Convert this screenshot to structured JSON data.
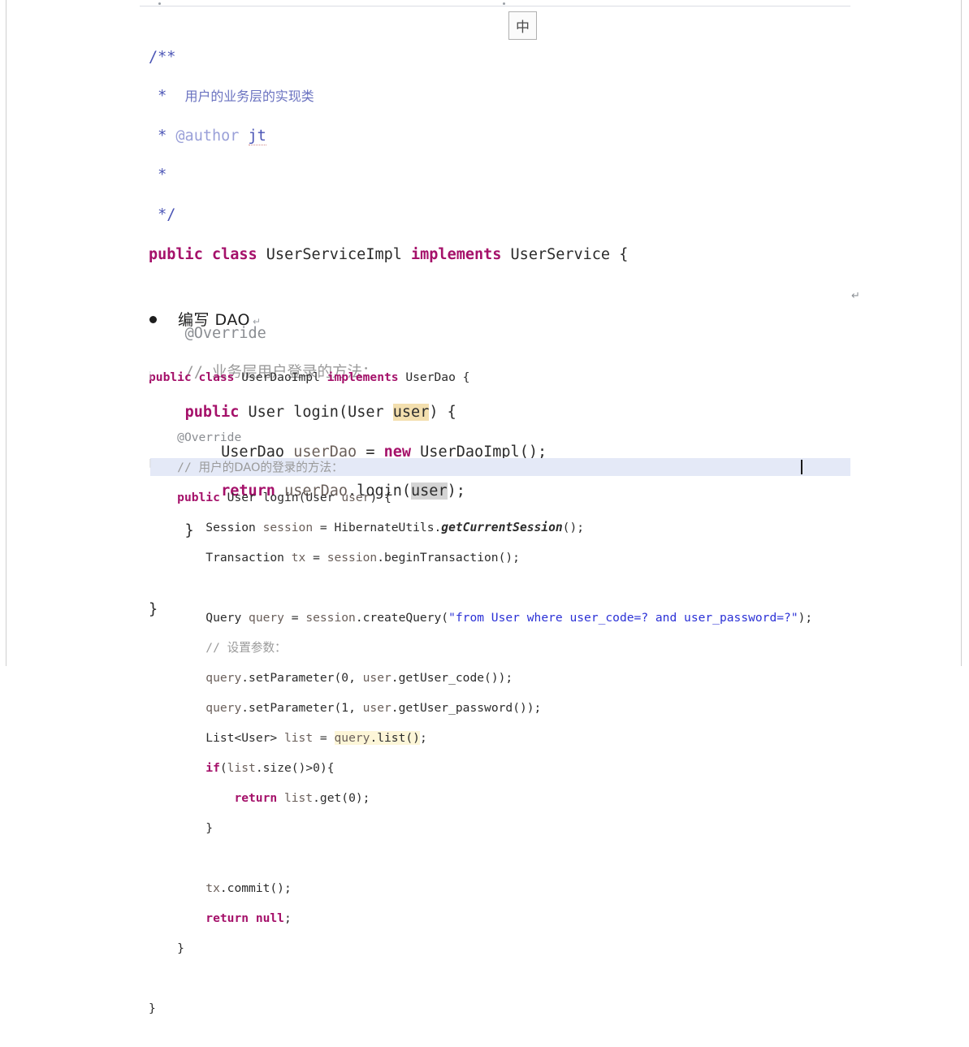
{
  "document": {
    "ime_indicator": {
      "label": "中",
      "name": "chinese-ime-mode"
    },
    "paragraph_mark": "↵",
    "bullet_item": {
      "marker": "●",
      "text": "编写 DAO",
      "pilcrow": "↵"
    }
  },
  "code_service": {
    "lines": [
      {
        "id": "svc-l1",
        "text": "/**"
      },
      {
        "id": "svc-l2",
        "text": " *  用户的业务层的实现类"
      },
      {
        "id": "svc-l3",
        "text": " * @author jt"
      },
      {
        "id": "svc-l4",
        "text": " *"
      },
      {
        "id": "svc-l5",
        "text": " */"
      },
      {
        "id": "svc-l6",
        "text": "public class UserServiceImpl implements UserService {"
      },
      {
        "id": "svc-l7",
        "text": ""
      },
      {
        "id": "svc-l8",
        "text": "    @Override"
      },
      {
        "id": "svc-l9",
        "text": "    // 业务层用户登录的方法："
      },
      {
        "id": "svc-l10",
        "text": "    public User login(User user) {"
      },
      {
        "id": "svc-l11",
        "text": "        UserDao userDao = new UserDaoImpl();"
      },
      {
        "id": "svc-l12",
        "text": "        return userDao.login(user);"
      },
      {
        "id": "svc-l13",
        "text": "    }"
      },
      {
        "id": "svc-l14",
        "text": ""
      },
      {
        "id": "svc-l15",
        "text": "}"
      }
    ],
    "doc_author_tag": "@author",
    "doc_author_value": "jt",
    "highlighted_tokens": [
      "user",
      "user"
    ]
  },
  "code_dao": {
    "lines": [
      {
        "id": "dao-l1",
        "text": "public class UserDaoImpl implements UserDao {"
      },
      {
        "id": "dao-l2",
        "text": ""
      },
      {
        "id": "dao-l3",
        "text": "    @Override"
      },
      {
        "id": "dao-l4",
        "text": "    // 用户的DAO的登录的方法："
      },
      {
        "id": "dao-l5",
        "text": "    public User login(User user) {"
      },
      {
        "id": "dao-l6",
        "text": "        Session session = HibernateUtils.getCurrentSession();"
      },
      {
        "id": "dao-l7",
        "text": "        Transaction tx = session.beginTransaction();"
      },
      {
        "id": "dao-l8",
        "text": ""
      },
      {
        "id": "dao-l9",
        "text": "        Query query = session.createQuery(\"from User where user_code=? and user_password=?\");"
      },
      {
        "id": "dao-l10",
        "text": "        // 设置参数："
      },
      {
        "id": "dao-l11",
        "text": "        query.setParameter(0, user.getUser_code());"
      },
      {
        "id": "dao-l12",
        "text": "        query.setParameter(1, user.getUser_password());"
      },
      {
        "id": "dao-l13",
        "text": "        List<User> list = query.list();"
      },
      {
        "id": "dao-l14",
        "text": "        if(list.size()>0){"
      },
      {
        "id": "dao-l15",
        "text": "            return list.get(0);"
      },
      {
        "id": "dao-l16",
        "text": "        }"
      },
      {
        "id": "dao-l17",
        "text": ""
      },
      {
        "id": "dao-l18",
        "text": "        tx.commit();"
      },
      {
        "id": "dao-l19",
        "text": "        return null;"
      },
      {
        "id": "dao-l20",
        "text": "    }"
      },
      {
        "id": "dao-l21",
        "text": ""
      },
      {
        "id": "dao-l22",
        "text": "}"
      }
    ],
    "hql_string": "\"from User where user_code=? and user_password=?\"",
    "selected_line_id": "dao-l9"
  },
  "colors": {
    "keyword": "#a5116a",
    "comment": "#9a9a9a",
    "javadoc": "#4a54b5",
    "string": "#2b31d6",
    "variable": "#6a5f5a",
    "selection_band": "#e4e9f7",
    "highlight_orange": "#f3dfae",
    "highlight_grey": "#d4d4d4",
    "page_border": "#cfcfcf"
  }
}
